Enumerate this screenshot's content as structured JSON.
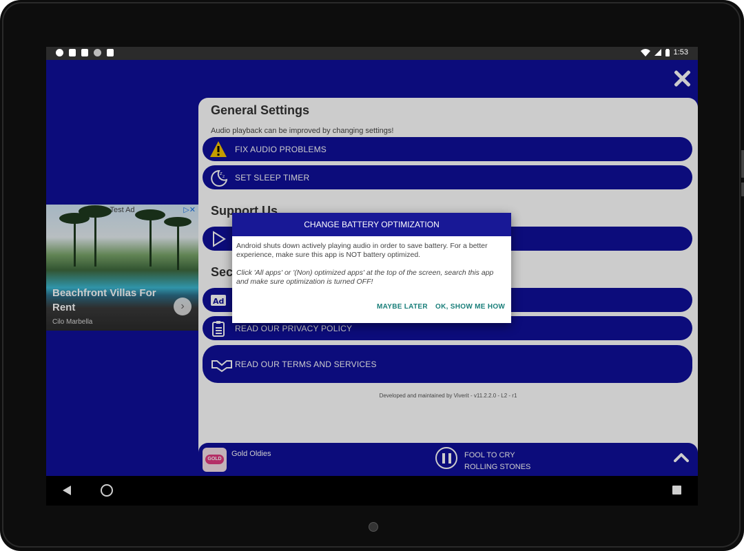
{
  "status_bar": {
    "time": "1:53"
  },
  "settings": {
    "general_title": "General Settings",
    "general_subtitle": "Audio playback can be improved by changing settings!",
    "fix_audio": "FIX AUDIO PROBLEMS",
    "sleep_timer": "SET SLEEP TIMER",
    "support_title": "Support Us",
    "security_title_partial": "Sec",
    "privacy": "READ OUR PRIVACY POLICY",
    "terms": "READ OUR TERMS AND SERVICES",
    "developer_note": "Developed and maintained by Viverit - v11.2.2.0 - L2 - r1"
  },
  "ad": {
    "tag": "Test Ad",
    "title": "Beachfront Villas For Rent",
    "source": "Cilo Marbella"
  },
  "player": {
    "station": "Gold Oldies",
    "station_logo": "GOLD",
    "track_title": "FOOL TO CRY",
    "track_artist": "ROLLING STONES"
  },
  "dialog": {
    "title": "CHANGE BATTERY OPTIMIZATION",
    "message": "Android shuts down actively playing audio in order to save battery. For a better experience, make sure this app is NOT battery optimized.",
    "note": "Click 'All apps' or '(Non) optimized apps' at the top of the screen, search this app and make sure optimization is turned OFF!",
    "maybe_later": "MAYBE LATER",
    "show_me_how": "OK, SHOW ME HOW"
  },
  "colors": {
    "brand_blue": "#10109a",
    "dialog_header": "#181896",
    "dialog_button": "#1a7f7a"
  }
}
